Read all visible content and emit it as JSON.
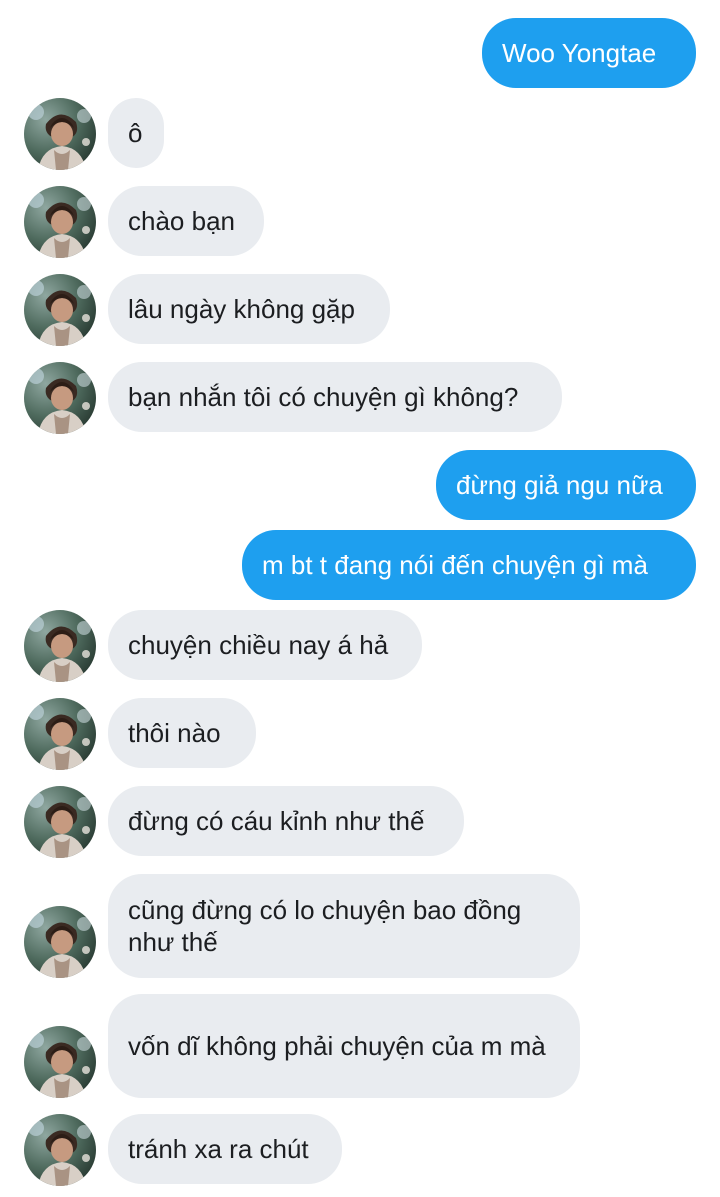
{
  "conversation": {
    "messages": [
      {
        "side": "out",
        "text": "Woo Yongtae"
      },
      {
        "side": "in",
        "text": "ô"
      },
      {
        "side": "in",
        "text": "chào bạn"
      },
      {
        "side": "in",
        "text": "lâu ngày không gặp"
      },
      {
        "side": "in",
        "text": "bạn nhắn tôi có chuyện gì không?"
      },
      {
        "side": "out",
        "text": "đừng giả ngu nữa"
      },
      {
        "side": "out",
        "text": "m bt t đang nói đến chuyện gì mà"
      },
      {
        "side": "in",
        "text": "chuyện chiều nay á hả"
      },
      {
        "side": "in",
        "text": "thôi nào"
      },
      {
        "side": "in",
        "text": "đừng có cáu kỉnh như thế"
      },
      {
        "side": "in",
        "text": "cũng đừng có lo chuyện bao đồng như thế"
      },
      {
        "side": "in",
        "text": "vốn dĩ không phải chuyện của m mà"
      },
      {
        "side": "in",
        "text": "tránh xa ra chút"
      }
    ]
  },
  "colors": {
    "outgoing_bubble": "#1e9fef",
    "incoming_bubble": "#e9ecf0"
  },
  "icons": {
    "avatar": "contact-avatar-photo"
  }
}
